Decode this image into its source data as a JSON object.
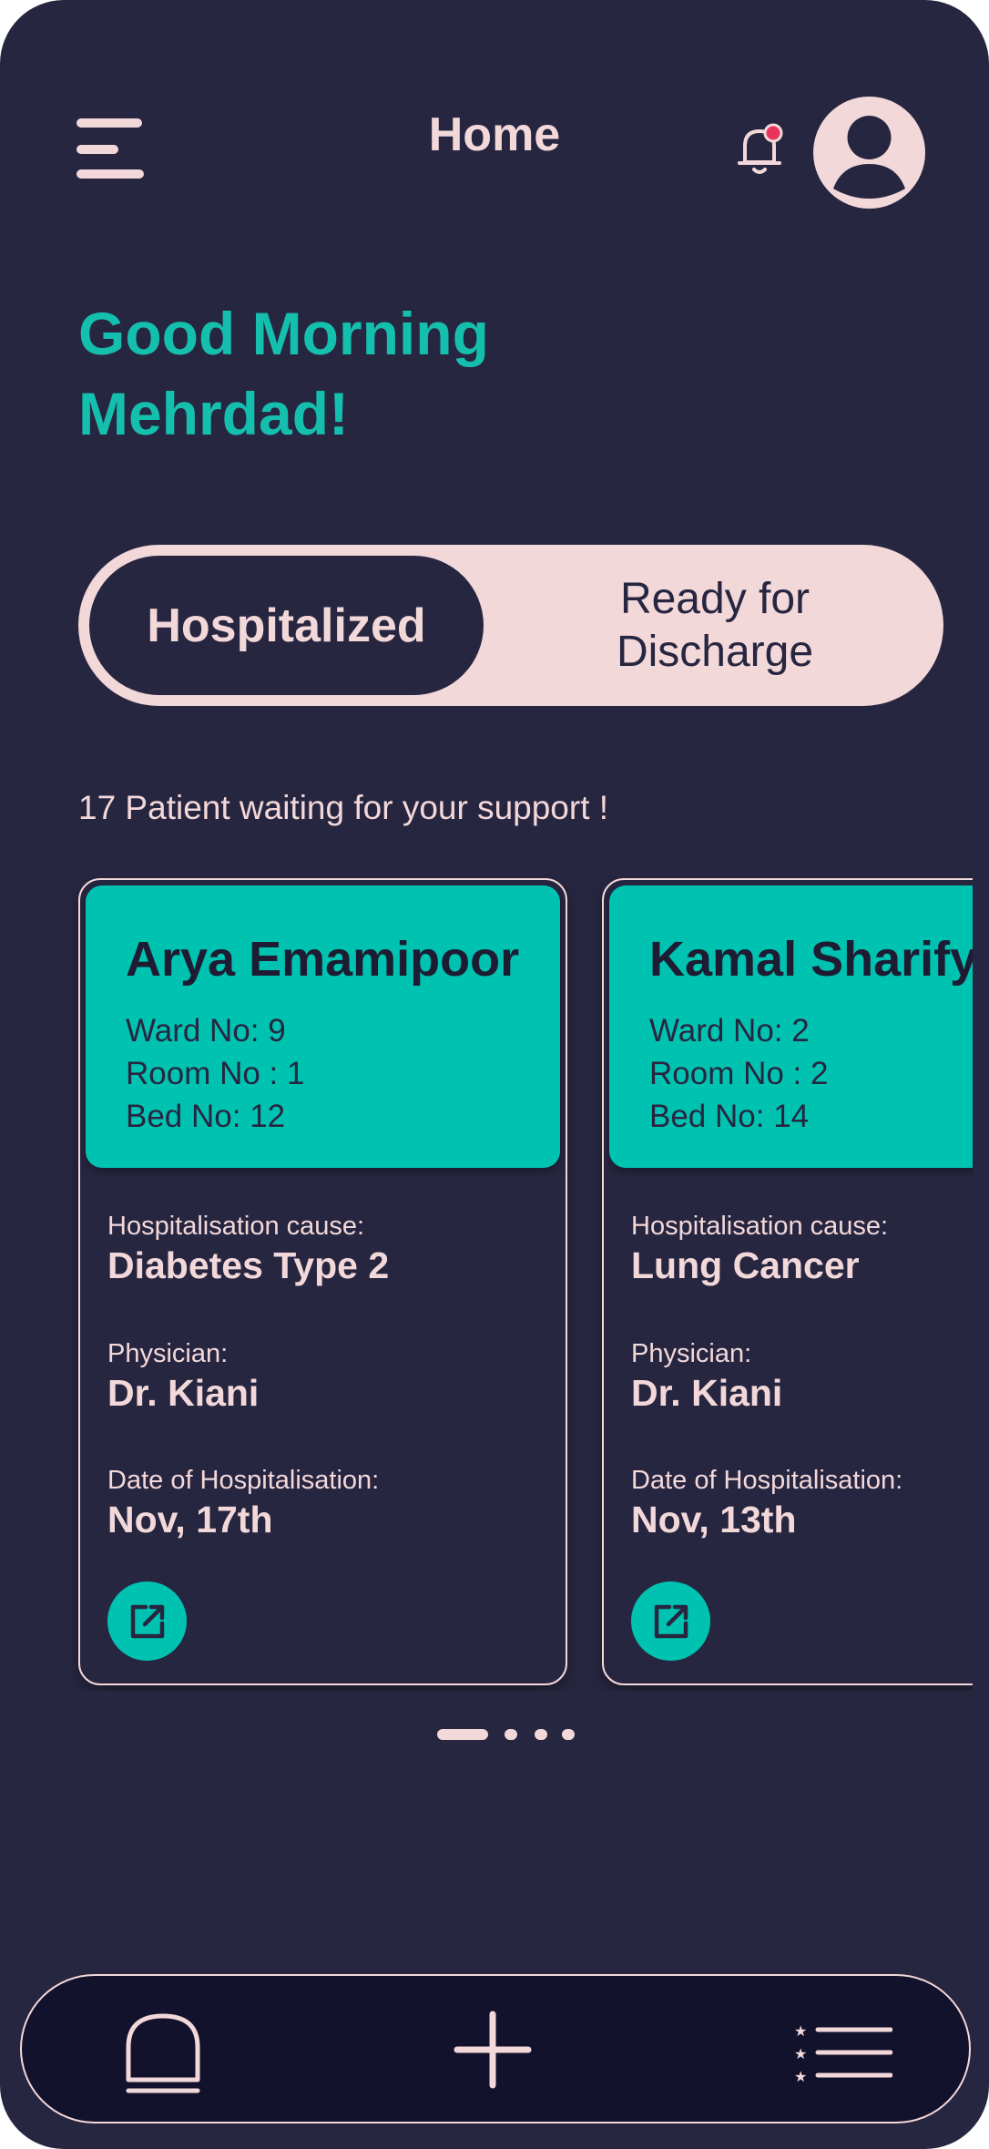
{
  "header": {
    "title": "Home",
    "menu_icon": "hamburger-icon",
    "notification_icon": "bell-icon",
    "notification_badge_color": "#e8335a",
    "avatar_icon": "user-icon"
  },
  "greeting": {
    "line1": "Good Morning",
    "line2": "Mehrdad!"
  },
  "tabs": {
    "active": "Hospitalized",
    "inactive_line1": "Ready for",
    "inactive_line2": "Discharge"
  },
  "waiting_text": "17 Patient waiting for your support !",
  "patients": [
    {
      "name": "Arya Emamipoor",
      "ward": "Ward No:  9",
      "room": "Room No : 1",
      "bed": "Bed No: 12",
      "cause_label": "Hospitalisation cause:",
      "cause": "Diabetes Type 2",
      "physician_label": "Physician:",
      "physician": "Dr. Kiani",
      "date_label": "Date of Hospitalisation:",
      "date": "Nov, 17th",
      "open_icon": "external-link-icon"
    },
    {
      "name": "Kamal Sharify",
      "ward": "Ward No:  2",
      "room": "Room No : 2",
      "bed": "Bed No: 14",
      "cause_label": "Hospitalisation cause:",
      "cause": "Lung Cancer",
      "physician_label": "Physician:",
      "physician": "Dr. Kiani",
      "date_label": "Date of Hospitalisation:",
      "date": "Nov, 13th",
      "open_icon": "external-link-icon"
    }
  ],
  "pager": {
    "pages": 4,
    "current": 1
  },
  "bottom_nav": {
    "items": [
      "home-icon",
      "plus-icon",
      "list-icon"
    ]
  },
  "colors": {
    "background": "#272640",
    "accent": "#00c2b1",
    "greeting": "#15bfae",
    "pink": "#f3d8da",
    "nav_bg": "#13122d"
  }
}
